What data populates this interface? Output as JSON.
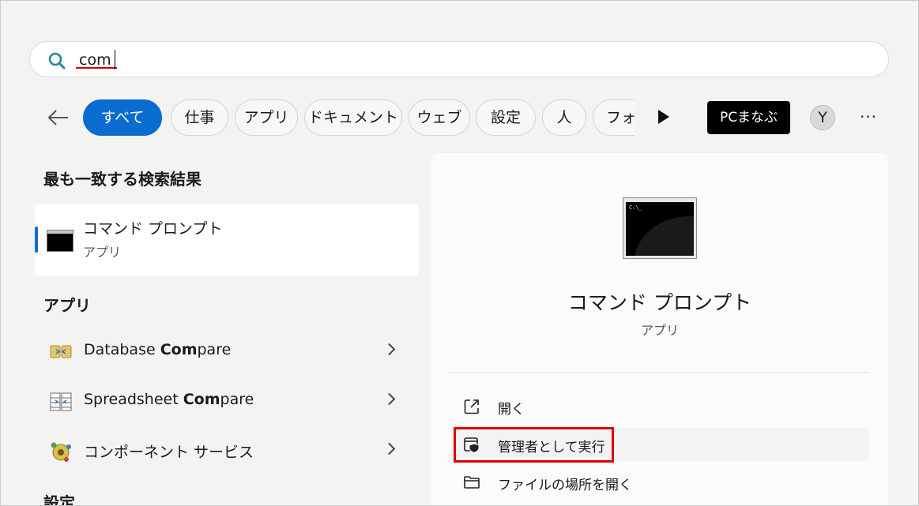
{
  "search": {
    "query": "com",
    "placeholder": ""
  },
  "filters": {
    "chips": [
      "すべて",
      "仕事",
      "アプリ",
      "ドキュメント",
      "ウェブ",
      "設定",
      "人",
      "フォルダー"
    ],
    "active_index": 0,
    "pc_button": "PCまなぶ",
    "avatar_letter": "Y",
    "more": "···"
  },
  "left": {
    "best_heading": "最も一致する検索結果",
    "best": {
      "title": "コマンド プロンプト",
      "subtitle": "アプリ"
    },
    "apps_heading": "アプリ",
    "apps": [
      {
        "pre": "Database ",
        "match": "Com",
        "post": "pare",
        "icon": "database-compare-icon"
      },
      {
        "pre": "Spreadsheet ",
        "match": "Com",
        "post": "pare",
        "icon": "spreadsheet-compare-icon"
      },
      {
        "pre": "コンポーネント サービス",
        "match": "",
        "post": "",
        "icon": "component-services-icon"
      }
    ],
    "settings_heading": "設定"
  },
  "right": {
    "title": "コマンド プロンプト",
    "subtitle": "アプリ",
    "icon_prompt": "C:\\_",
    "actions": [
      {
        "label": "開く",
        "icon": "open-external-icon"
      },
      {
        "label": "管理者として実行",
        "icon": "run-as-admin-shield-icon"
      },
      {
        "label": "ファイルの場所を開く",
        "icon": "folder-icon"
      }
    ]
  },
  "colors": {
    "accent": "#0a6cd0",
    "highlight_box": "#e00000"
  }
}
